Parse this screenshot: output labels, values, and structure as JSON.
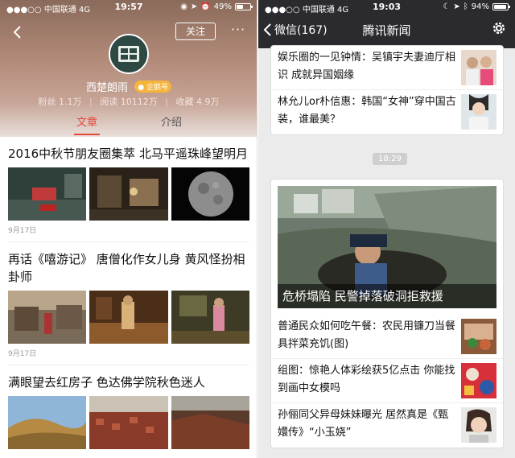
{
  "left": {
    "status": {
      "carrier": "中国联通",
      "network": "4G",
      "time": "19:57",
      "battery": "49%",
      "battery_level": 0.49
    },
    "follow_label": "关注",
    "more_label": "···",
    "account": {
      "name": "西楚朗雨",
      "badge": "企鹅号"
    },
    "stats": {
      "fans": "粉丝 1.1万",
      "reads": "阅读 10112万",
      "favorites": "收藏 4.9万",
      "sep": "|"
    },
    "tabs": [
      {
        "label": "文章"
      },
      {
        "label": "介绍"
      }
    ],
    "articles": [
      {
        "title": "2016中秋节朋友圈集萃 北马平遥珠峰望明月",
        "date": "9月17日"
      },
      {
        "title": "再话《嘻游记》 唐僧化作女儿身 黄风怪扮相卦师",
        "date": "9月17日"
      },
      {
        "title": "满眼望去红房子 色达佛学院秋色迷人",
        "date": ""
      }
    ]
  },
  "right": {
    "status": {
      "carrier": "中国联通",
      "network": "4G",
      "time": "19:03",
      "battery": "94%",
      "battery_level": 0.94
    },
    "back_label": "微信(167)",
    "title": "腾讯新闻",
    "card1": [
      {
        "title": "娱乐圈的一见钟情：吴镇宇夫妻迪厅相识 成就异国姻缘"
      },
      {
        "title": "林允儿or朴信惠：韩国“女神”穿中国古装，谁最美？"
      }
    ],
    "timestamp": "18:29",
    "lead_caption": "危桥塌陷 民警掉落破洞拒救援",
    "card2": [
      {
        "title": "普通民众如何吃午餐：农民用镰刀当餐具拌菜充饥(图)"
      },
      {
        "title": "组图：惊艳人体彩绘获5亿点击 你能找到画中女模吗"
      },
      {
        "title": "孙俪同父异母妹妹曝光 居然真是《甄嬛传》“小玉娆”"
      }
    ]
  }
}
